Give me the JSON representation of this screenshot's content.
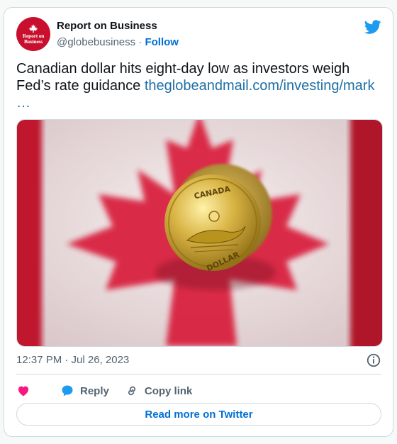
{
  "author": {
    "name": "Report on Business",
    "handle": "@globebusiness",
    "separator": " · ",
    "follow_label": "Follow",
    "avatar": {
      "line1": "Report on",
      "line2": "Business",
      "color": "#c8102e"
    }
  },
  "tweet": {
    "text": "Canadian dollar hits eight-day low as investors weigh Fed’s rate guidance ",
    "link": "theglobeandmail.com/investing/mark",
    "ellipsis": "…"
  },
  "media": {
    "description_icon": "loonie-coin-on-canadian-flag",
    "coin_text_top": "CANADA",
    "coin_text_bottom": "DOLLAR"
  },
  "meta": {
    "timestamp": "12:37 PM · Jul 26, 2023"
  },
  "actions": {
    "reply_label": "Reply",
    "copy_link_label": "Copy link"
  },
  "read_more_label": "Read more on Twitter",
  "colors": {
    "accent": "#006fd6",
    "link": "#1d6fa5",
    "twitter_blue": "#1d9bf0",
    "heart": "#f91880",
    "muted": "#536471"
  }
}
